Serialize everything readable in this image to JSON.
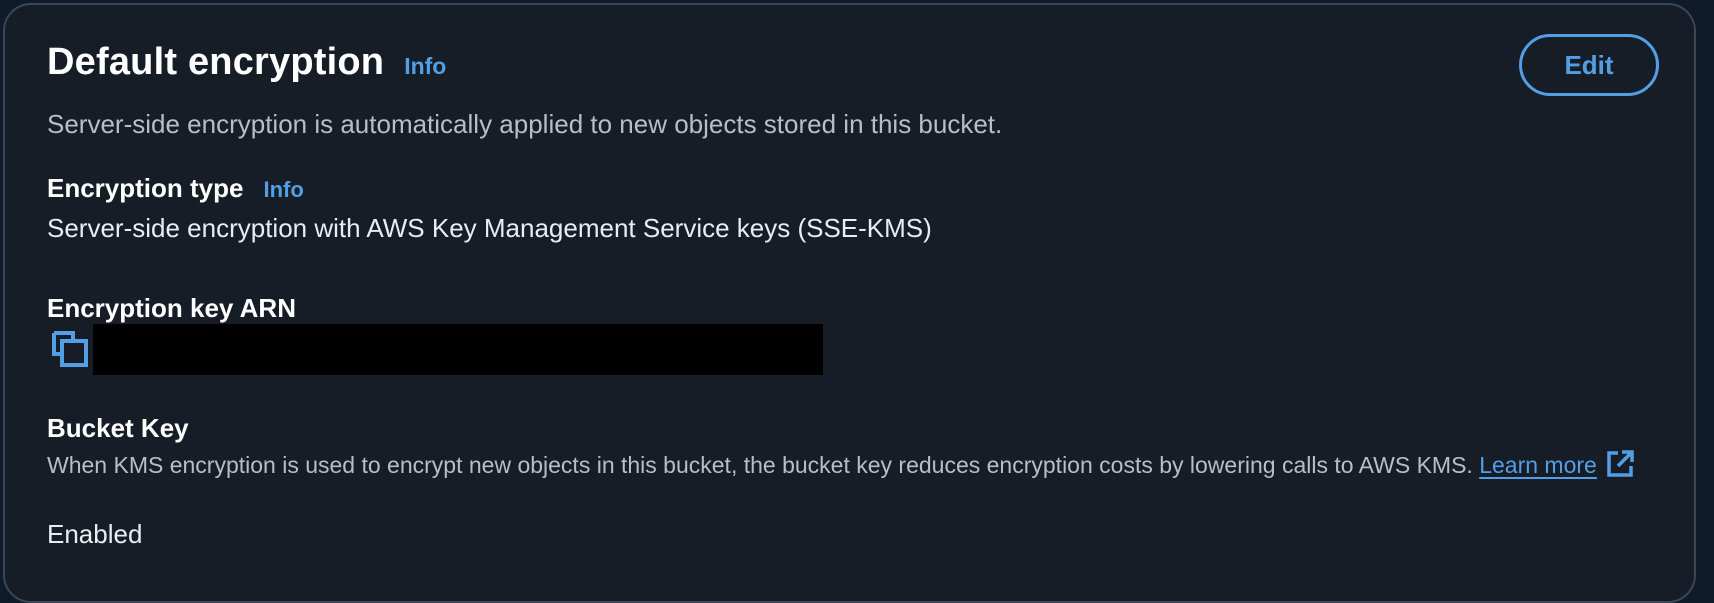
{
  "header": {
    "title": "Default encryption",
    "info_label": "Info",
    "description": "Server-side encryption is automatically applied to new objects stored in this bucket.",
    "edit_label": "Edit"
  },
  "encryption_type": {
    "label": "Encryption type",
    "info_label": "Info",
    "value": "Server-side encryption with AWS Key Management Service keys (SSE-KMS)"
  },
  "encryption_key_arn": {
    "label": "Encryption key ARN",
    "copy_icon": "copy-icon"
  },
  "bucket_key": {
    "label": "Bucket Key",
    "description": "When KMS encryption is used to encrypt new objects in this bucket, the bucket key reduces encryption costs by lowering calls to AWS KMS.",
    "learn_more_label": "Learn more",
    "learn_more_icon": "external-link-icon",
    "value": "Enabled"
  },
  "colors": {
    "panel_background": "#161d26",
    "panel_border": "#3d4654",
    "link": "#539fe5",
    "heading": "#ffffff",
    "secondary_text": "#b6bec9"
  }
}
